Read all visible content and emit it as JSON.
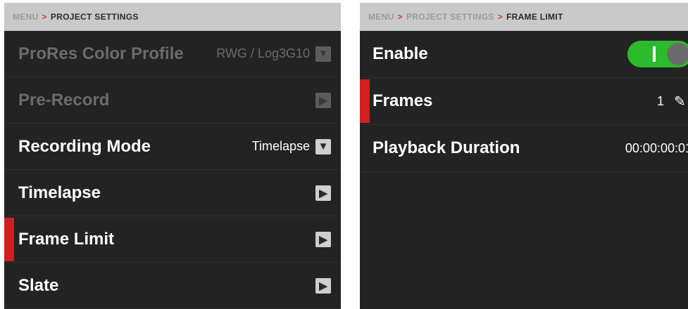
{
  "left": {
    "breadcrumb": {
      "root": "MENU",
      "sep": ">",
      "current": "PROJECT SETTINGS"
    },
    "items": [
      {
        "label": "ProRes Color Profile",
        "value": "RWG / Log3G10",
        "control": "▼"
      },
      {
        "label": "Pre-Record",
        "value": "",
        "control": "▶"
      },
      {
        "label": "Recording Mode",
        "value": "Timelapse",
        "control": "▼"
      },
      {
        "label": "Timelapse",
        "value": "",
        "control": "▶"
      },
      {
        "label": "Frame Limit",
        "value": "",
        "control": "▶"
      },
      {
        "label": "Slate",
        "value": "",
        "control": "▶"
      }
    ]
  },
  "right": {
    "breadcrumb": {
      "root": "MENU",
      "sep1": ">",
      "mid": "PROJECT SETTINGS",
      "sep2": ">",
      "current": "FRAME LIMIT"
    },
    "items": [
      {
        "label": "Enable",
        "toggle": "on"
      },
      {
        "label": "Frames",
        "value": "1",
        "edit": "✎"
      },
      {
        "label": "Playback Duration",
        "value": "00:00:00:01"
      }
    ]
  },
  "colors": {
    "indicator": "#d11e1e",
    "toggle_on": "#2bbb2b",
    "breadcrumb_bg": "#c9c9c9"
  },
  "icons": {
    "dropdown": "chevron-down-icon",
    "submenu": "chevron-right-icon",
    "edit": "pencil-icon"
  }
}
